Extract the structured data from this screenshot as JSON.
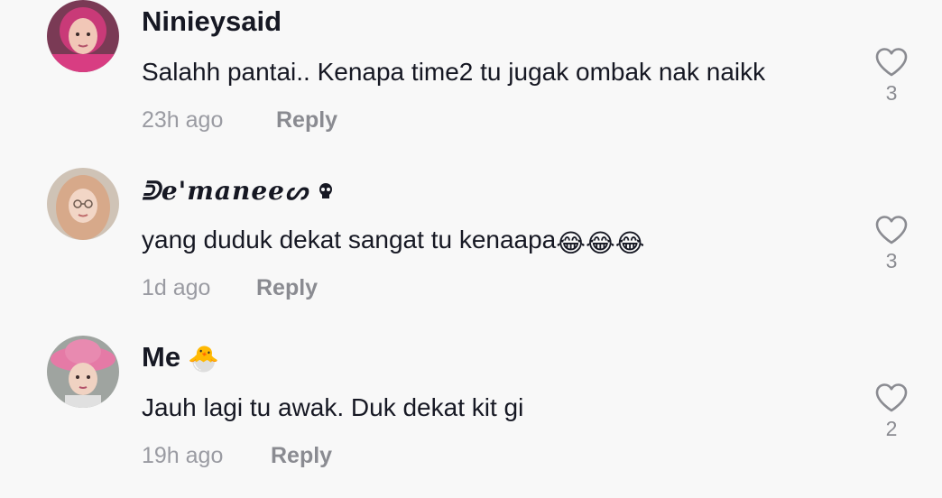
{
  "comments": [
    {
      "username": "Ninieysaid",
      "text": "Salahh pantai.. Kenapa time2 tu jugak ombak nak naikk",
      "time": "23h ago",
      "reply_label": "Reply",
      "likes": "3",
      "avatar_icon": "user-photo-pink-hijab"
    },
    {
      "username": "ᕲe'maneeᔕ",
      "username_suffix_icon": "skull-ornament-icon",
      "text": "yang duduk dekat sangat tu kenaapa",
      "text_emojis": [
        "😂",
        "😂",
        "😂"
      ],
      "time": "1d ago",
      "reply_label": "Reply",
      "likes": "3",
      "avatar_icon": "user-photo-beige-hijab"
    },
    {
      "username": "Me",
      "username_emoji": "🐣",
      "text": "Jauh lagi tu awak. Duk dekat kit gi",
      "time": "19h ago",
      "reply_label": "Reply",
      "likes": "2",
      "avatar_icon": "user-photo-pink-bucket-hat"
    }
  ],
  "colors": {
    "background": "#f8f8f8",
    "text_primary": "#161823",
    "text_secondary": "#9a9ba2",
    "heart_outline": "#8a8b91"
  }
}
